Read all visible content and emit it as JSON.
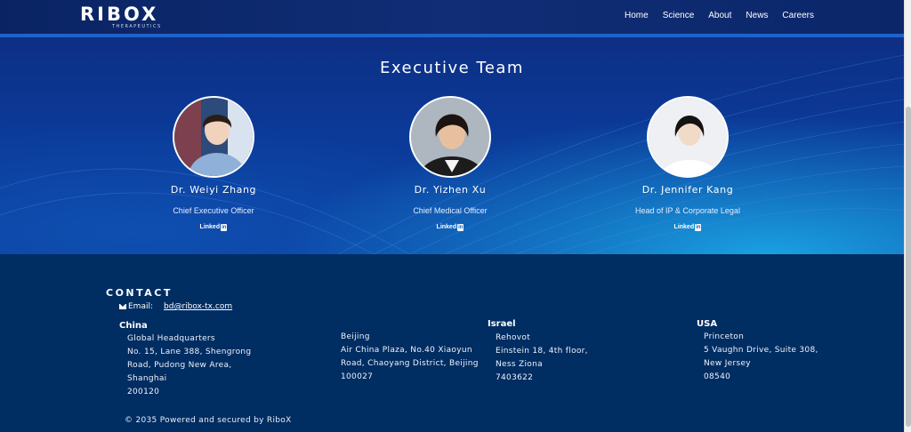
{
  "header": {
    "logo_text": "RIBOX",
    "logo_sub": "THERAPEUTICS",
    "nav": [
      "Home",
      "Science",
      "About",
      "News",
      "Careers"
    ]
  },
  "team": {
    "title": "Executive Team",
    "members": [
      {
        "name": "Dr. Weiyi Zhang",
        "role": "Chief Executive Officer",
        "linkedin": "Linked",
        "linkedin_in": "in"
      },
      {
        "name": "Dr. Yizhen Xu",
        "role": "Chief Medical Officer",
        "linkedin": "Linked",
        "linkedin_in": "in"
      },
      {
        "name": "Dr. Jennifer Kang",
        "role": "Head of IP & Corporate Legal",
        "linkedin": "Linked",
        "linkedin_in": "in"
      }
    ]
  },
  "footer": {
    "contact_title": "CONTACT",
    "email_label": "Email:",
    "email": "bd@ribox-tx.com",
    "regions": [
      {
        "name": "China",
        "lines": [
          "Global Headquarters",
          "No. 15, Lane 388, Shengrong",
          "Road, Pudong New Area,",
          "Shanghai",
          "200120"
        ]
      },
      {
        "name": "",
        "lines": [
          "Beijing",
          "Air China Plaza, No.40 Xiaoyun",
          "Road, Chaoyang District, Beijing",
          "100027"
        ]
      },
      {
        "name": "Israel",
        "lines": [
          "Rehovot",
          "Einstein 18, 4th floor,",
          "Ness Ziona",
          "7403622"
        ]
      },
      {
        "name": "USA",
        "lines": [
          "Princeton",
          "5 Vaughn Drive, Suite 308,",
          "New Jersey",
          "08540"
        ]
      }
    ],
    "copyright": "© 2035 Powered and secured by RiboX"
  },
  "colors": {
    "header_bg": "#0a2463",
    "accent": "#1e63c9",
    "footer_bg": "#002d62"
  }
}
